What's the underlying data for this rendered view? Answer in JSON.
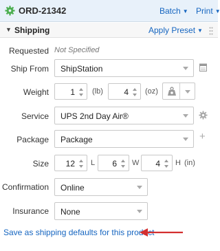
{
  "header": {
    "order_id": "ORD-21342",
    "batch_label": "Batch",
    "print_label": "Print"
  },
  "section": {
    "title": "Shipping",
    "apply_preset_label": "Apply Preset"
  },
  "form": {
    "requested": {
      "label": "Requested",
      "value": "Not Specified"
    },
    "ship_from": {
      "label": "Ship From",
      "value": "ShipStation"
    },
    "weight": {
      "label": "Weight",
      "lb_value": "1",
      "lb_unit": "(lb)",
      "oz_value": "4",
      "oz_unit": "(oz)"
    },
    "service": {
      "label": "Service",
      "value": "UPS 2nd Day Air®"
    },
    "package": {
      "label": "Package",
      "value": "Package"
    },
    "size": {
      "label": "Size",
      "l_value": "12",
      "l_unit": "L",
      "w_value": "6",
      "w_unit": "W",
      "h_value": "4",
      "h_unit": "H",
      "units": "(in)"
    },
    "confirmation": {
      "label": "Confirmation",
      "value": "Online"
    },
    "insurance": {
      "label": "Insurance",
      "value": "None"
    }
  },
  "footer": {
    "save_defaults_link": "Save as shipping defaults for this product"
  },
  "colors": {
    "link": "#1565c0",
    "header_bg": "#e8f1fa",
    "annotation_arrow": "#d32f2f"
  }
}
